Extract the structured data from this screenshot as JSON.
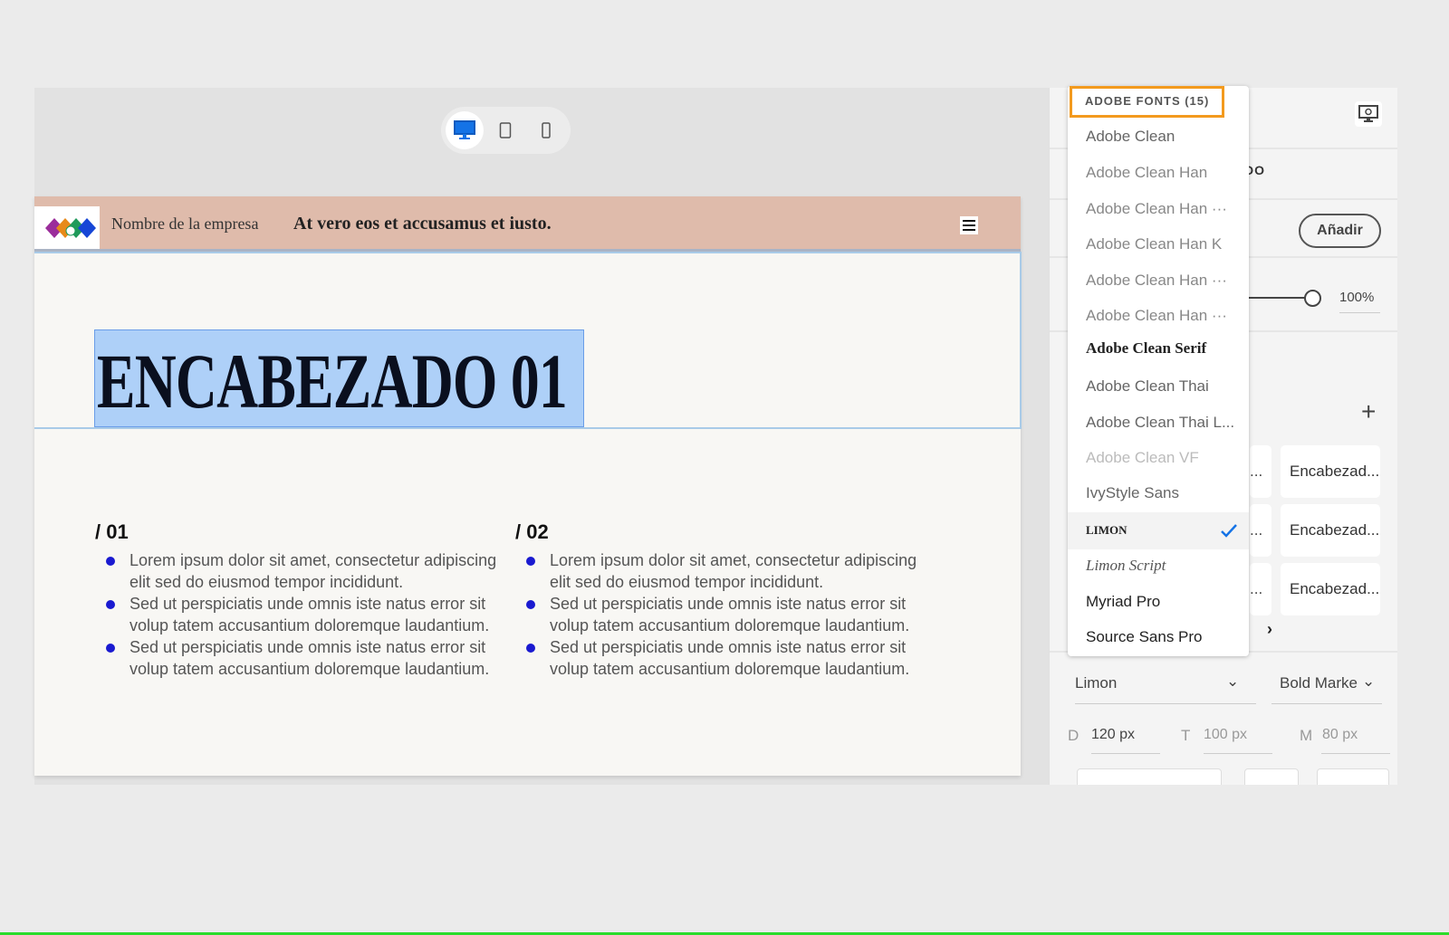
{
  "preview": {
    "devices": [
      {
        "name": "desktop",
        "active": true
      },
      {
        "name": "tablet",
        "active": false
      },
      {
        "name": "mobile",
        "active": false
      }
    ],
    "header": {
      "company": "Nombre de la empresa",
      "tagline": "At vero eos et accusamus et iusto."
    },
    "heading": "ENCABEZADO 01",
    "columns": [
      {
        "number": "/ 01",
        "items": [
          "Lorem ipsum dolor sit amet, consectetur adipiscing elit sed do eiusmod tempor incididunt.",
          "Sed ut perspiciatis unde omnis iste natus error sit volup tatem accusantium doloremque laudantium.",
          "Sed ut perspiciatis unde omnis iste natus error sit volup tatem accusantium doloremque laudantium."
        ]
      },
      {
        "number": "/ 02",
        "items": [
          "Lorem ipsum dolor sit amet, consectetur adipiscing elit sed do eiusmod tempor incididunt.",
          "Sed ut perspiciatis unde omnis iste natus error sit volup tatem accusantium doloremque laudantium.",
          "Sed ut perspiciatis unde omnis iste natus error sit volup tatem accusantium doloremque laudantium."
        ]
      }
    ],
    "accent": "#1a1ad0"
  },
  "panel": {
    "section_title_partial": "DO",
    "add_button": "Añadir",
    "opacity": "100%",
    "add_icon": "+",
    "styles": [
      "Encabezad...",
      "Encabezad...",
      "Encabezad..."
    ],
    "partial_card": "...",
    "font_family": "Limon",
    "font_weight": "Bold Marke",
    "sizes": [
      {
        "label": "D",
        "value": "120 px"
      },
      {
        "label": "T",
        "value": "100 px"
      },
      {
        "label": "M",
        "value": "80 px"
      }
    ]
  },
  "font_dropdown": {
    "header": "ADOBE FONTS (15)",
    "items": [
      "Adobe Clean",
      "Adobe Clean Han",
      "Adobe Clean Han ···",
      "Adobe Clean Han K",
      "Adobe Clean Han ···",
      "Adobe Clean Han ···",
      "Adobe Clean Serif",
      "Adobe Clean Thai",
      "Adobe Clean Thai L...",
      "Adobe Clean VF",
      "IvyStyle Sans",
      "LIMON",
      "Limon Script",
      "Myriad Pro",
      "Source Sans Pro"
    ],
    "selected": "LIMON",
    "highlight_color": "#f39a1e"
  }
}
